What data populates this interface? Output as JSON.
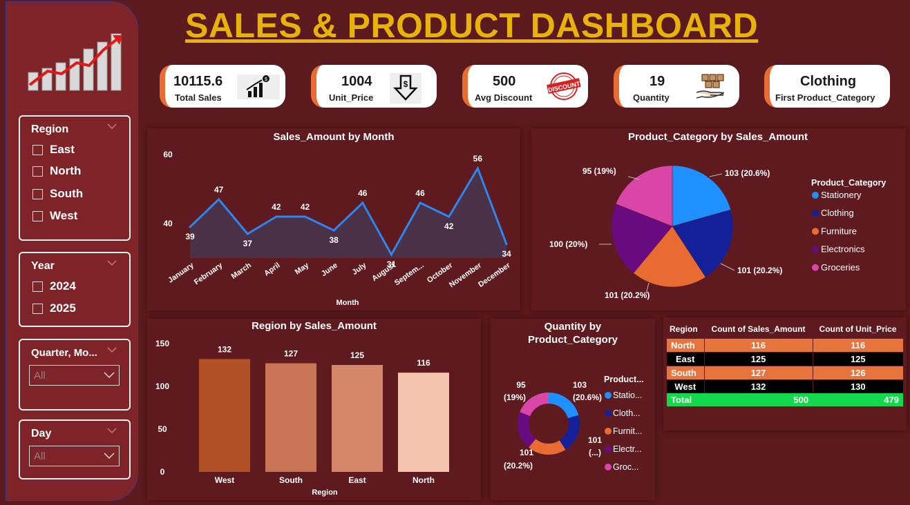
{
  "title": "SALES & PRODUCT DASHBOARD",
  "slicers": {
    "region": {
      "title": "Region",
      "options": [
        "East",
        "North",
        "South",
        "West"
      ]
    },
    "year": {
      "title": "Year",
      "options": [
        "2024",
        "2025"
      ]
    },
    "quarter": {
      "title": "Quarter, Mo...",
      "value": "All"
    },
    "day": {
      "title": "Day",
      "value": "All"
    }
  },
  "kpis": [
    {
      "value": "10115.6",
      "label": "Total Sales",
      "icon": "growth-chart-icon"
    },
    {
      "value": "1004",
      "label": "Unit_Price",
      "icon": "price-down-icon"
    },
    {
      "value": "500",
      "label": "Avg Discount",
      "icon": "discount-stamp-icon"
    },
    {
      "value": "19",
      "label": "Quantity",
      "icon": "boxes-hand-icon"
    },
    {
      "value": "Clothing",
      "label": "First Product_Category",
      "icon": ""
    }
  ],
  "colors": {
    "stationery": "#1e90ff",
    "clothing": "#13209a",
    "furniture": "#e86c32",
    "electronics": "#6a0a80",
    "groceries": "#d946a8",
    "line": "#2b86f0",
    "area": "#4a3148",
    "bars": [
      "#b15026",
      "#c97454",
      "#d6876a",
      "#f4c4ae"
    ],
    "table_orange": "#e8743d",
    "table_total": "#15d94c"
  },
  "chart_data": [
    {
      "type": "area",
      "title": "Sales_Amount by Month",
      "xlabel": "Month",
      "categories": [
        "January",
        "February",
        "March",
        "April",
        "May",
        "June",
        "July",
        "August",
        "Septem...",
        "October",
        "November",
        "December"
      ],
      "values": [
        39,
        47,
        37,
        42,
        42,
        38,
        46,
        31,
        46,
        42,
        56,
        34
      ],
      "y_ticks": [
        "40",
        "60"
      ],
      "ylim": [
        30,
        60
      ]
    },
    {
      "type": "pie",
      "title": "Product_Category by Sales_Amount",
      "legend_title": "Product_Category",
      "categories": [
        "Stationery",
        "Clothing",
        "Furniture",
        "Electronics",
        "Groceries"
      ],
      "values": [
        103,
        101,
        101,
        100,
        95
      ],
      "labels": [
        "103 (20.6%)",
        "101 (20.2%)",
        "101 (20.2%)",
        "100 (20%)",
        "95 (19%)"
      ]
    },
    {
      "type": "bar",
      "title": "Region by Sales_Amount",
      "xlabel": "Region",
      "categories": [
        "West",
        "South",
        "East",
        "North"
      ],
      "values": [
        132,
        127,
        125,
        116
      ],
      "y_ticks": [
        "0",
        "50",
        "100",
        "150"
      ],
      "ylim": [
        0,
        150
      ]
    },
    {
      "type": "pie",
      "title_lines": [
        "Quantity by",
        "Product_Category"
      ],
      "legend_title": "Product...",
      "categories": [
        "Statio...",
        "Cloth...",
        "Furnit...",
        "Electr...",
        "Groc..."
      ],
      "values": [
        103,
        101,
        101,
        100,
        95
      ],
      "labels": {
        "groceries": [
          "95",
          "(19%)"
        ],
        "stationery": [
          "103",
          "(20.6%)"
        ],
        "clothing": [
          "101",
          "(...)"
        ],
        "furniture": [
          "101",
          "(20.2%)"
        ]
      }
    },
    {
      "type": "table",
      "columns": [
        "Region",
        "Count of Sales_Amount",
        "Count of Unit_Price"
      ],
      "rows": [
        [
          "North",
          "116",
          "116"
        ],
        [
          "East",
          "125",
          "125"
        ],
        [
          "South",
          "127",
          "126"
        ],
        [
          "West",
          "132",
          "130"
        ]
      ],
      "total": [
        "Total",
        "500",
        "479"
      ]
    }
  ]
}
